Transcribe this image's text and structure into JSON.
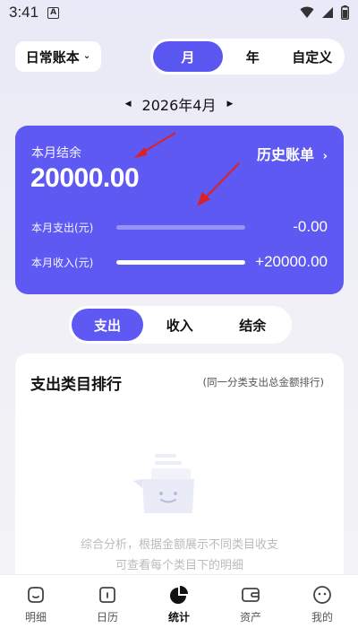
{
  "status_bar": {
    "time": "3:41",
    "notification_letter": "A"
  },
  "header": {
    "ledger": "日常账本",
    "period_tabs": [
      "月",
      "年",
      "自定义"
    ],
    "active_period": "月"
  },
  "month_nav": {
    "label": "2026年4月"
  },
  "summary": {
    "label": "本月结余",
    "amount": "20000.00",
    "history_link": "历史账单",
    "expense_label": "本月支出(元)",
    "expense_value": "-0.00",
    "expense_fraction": 0.0,
    "income_label": "本月收入(元)",
    "income_value": "+20000.00",
    "income_fraction": 1.0
  },
  "segments": {
    "items": [
      "支出",
      "收入",
      "结余"
    ],
    "active": "支出"
  },
  "ranking": {
    "title": "支出类目排行",
    "note": "(同一分类支出总金额排行)",
    "empty_line1": "综合分析，根据金额展示不同类目收支",
    "empty_line2": "可查看每个类目下的明细"
  },
  "bottom_nav": {
    "items": [
      {
        "label": "明细",
        "icon": "detail-icon"
      },
      {
        "label": "日历",
        "icon": "calendar-icon"
      },
      {
        "label": "统计",
        "icon": "pie-chart-icon"
      },
      {
        "label": "资产",
        "icon": "wallet-icon"
      },
      {
        "label": "我的",
        "icon": "profile-icon"
      }
    ],
    "active": "统计"
  },
  "colors": {
    "accent": "#5d59f2",
    "annotation_arrow": "#e02020"
  }
}
